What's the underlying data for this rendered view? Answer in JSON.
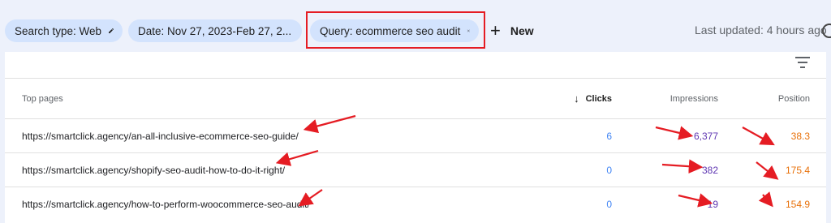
{
  "filters": {
    "chips": [
      {
        "label": "Search type: Web",
        "icon": "pencil-icon"
      },
      {
        "label": "Date: Nov 27, 2023-Feb 27, 2...",
        "icon": "pencil-icon"
      },
      {
        "label": "Query: ecommerce seo audit",
        "icon": "close-icon"
      }
    ],
    "new_label": "New",
    "last_updated": "Last updated: 4 hours ago"
  },
  "table": {
    "headers": {
      "page": "Top pages",
      "clicks": "Clicks",
      "impressions": "Impressions",
      "position": "Position"
    },
    "sort_icon": "arrow-down-icon",
    "rows": [
      {
        "page": "https://smartclick.agency/an-all-inclusive-ecommerce-seo-guide/",
        "clicks": "6",
        "impressions": "6,377",
        "position": "38.3"
      },
      {
        "page": "https://smartclick.agency/shopify-seo-audit-how-to-do-it-right/",
        "clicks": "0",
        "impressions": "382",
        "position": "175.4"
      },
      {
        "page": "https://smartclick.agency/how-to-perform-woocommerce-seo-audit/",
        "clicks": "0",
        "impressions": "19",
        "position": "154.9"
      }
    ]
  },
  "colors": {
    "background": "#edf1fb",
    "chip": "#d3e3fd",
    "clicks": "#4285f4",
    "impressions": "#5e35b1",
    "position": "#e8710a",
    "annotation_red": "#e51c23"
  }
}
